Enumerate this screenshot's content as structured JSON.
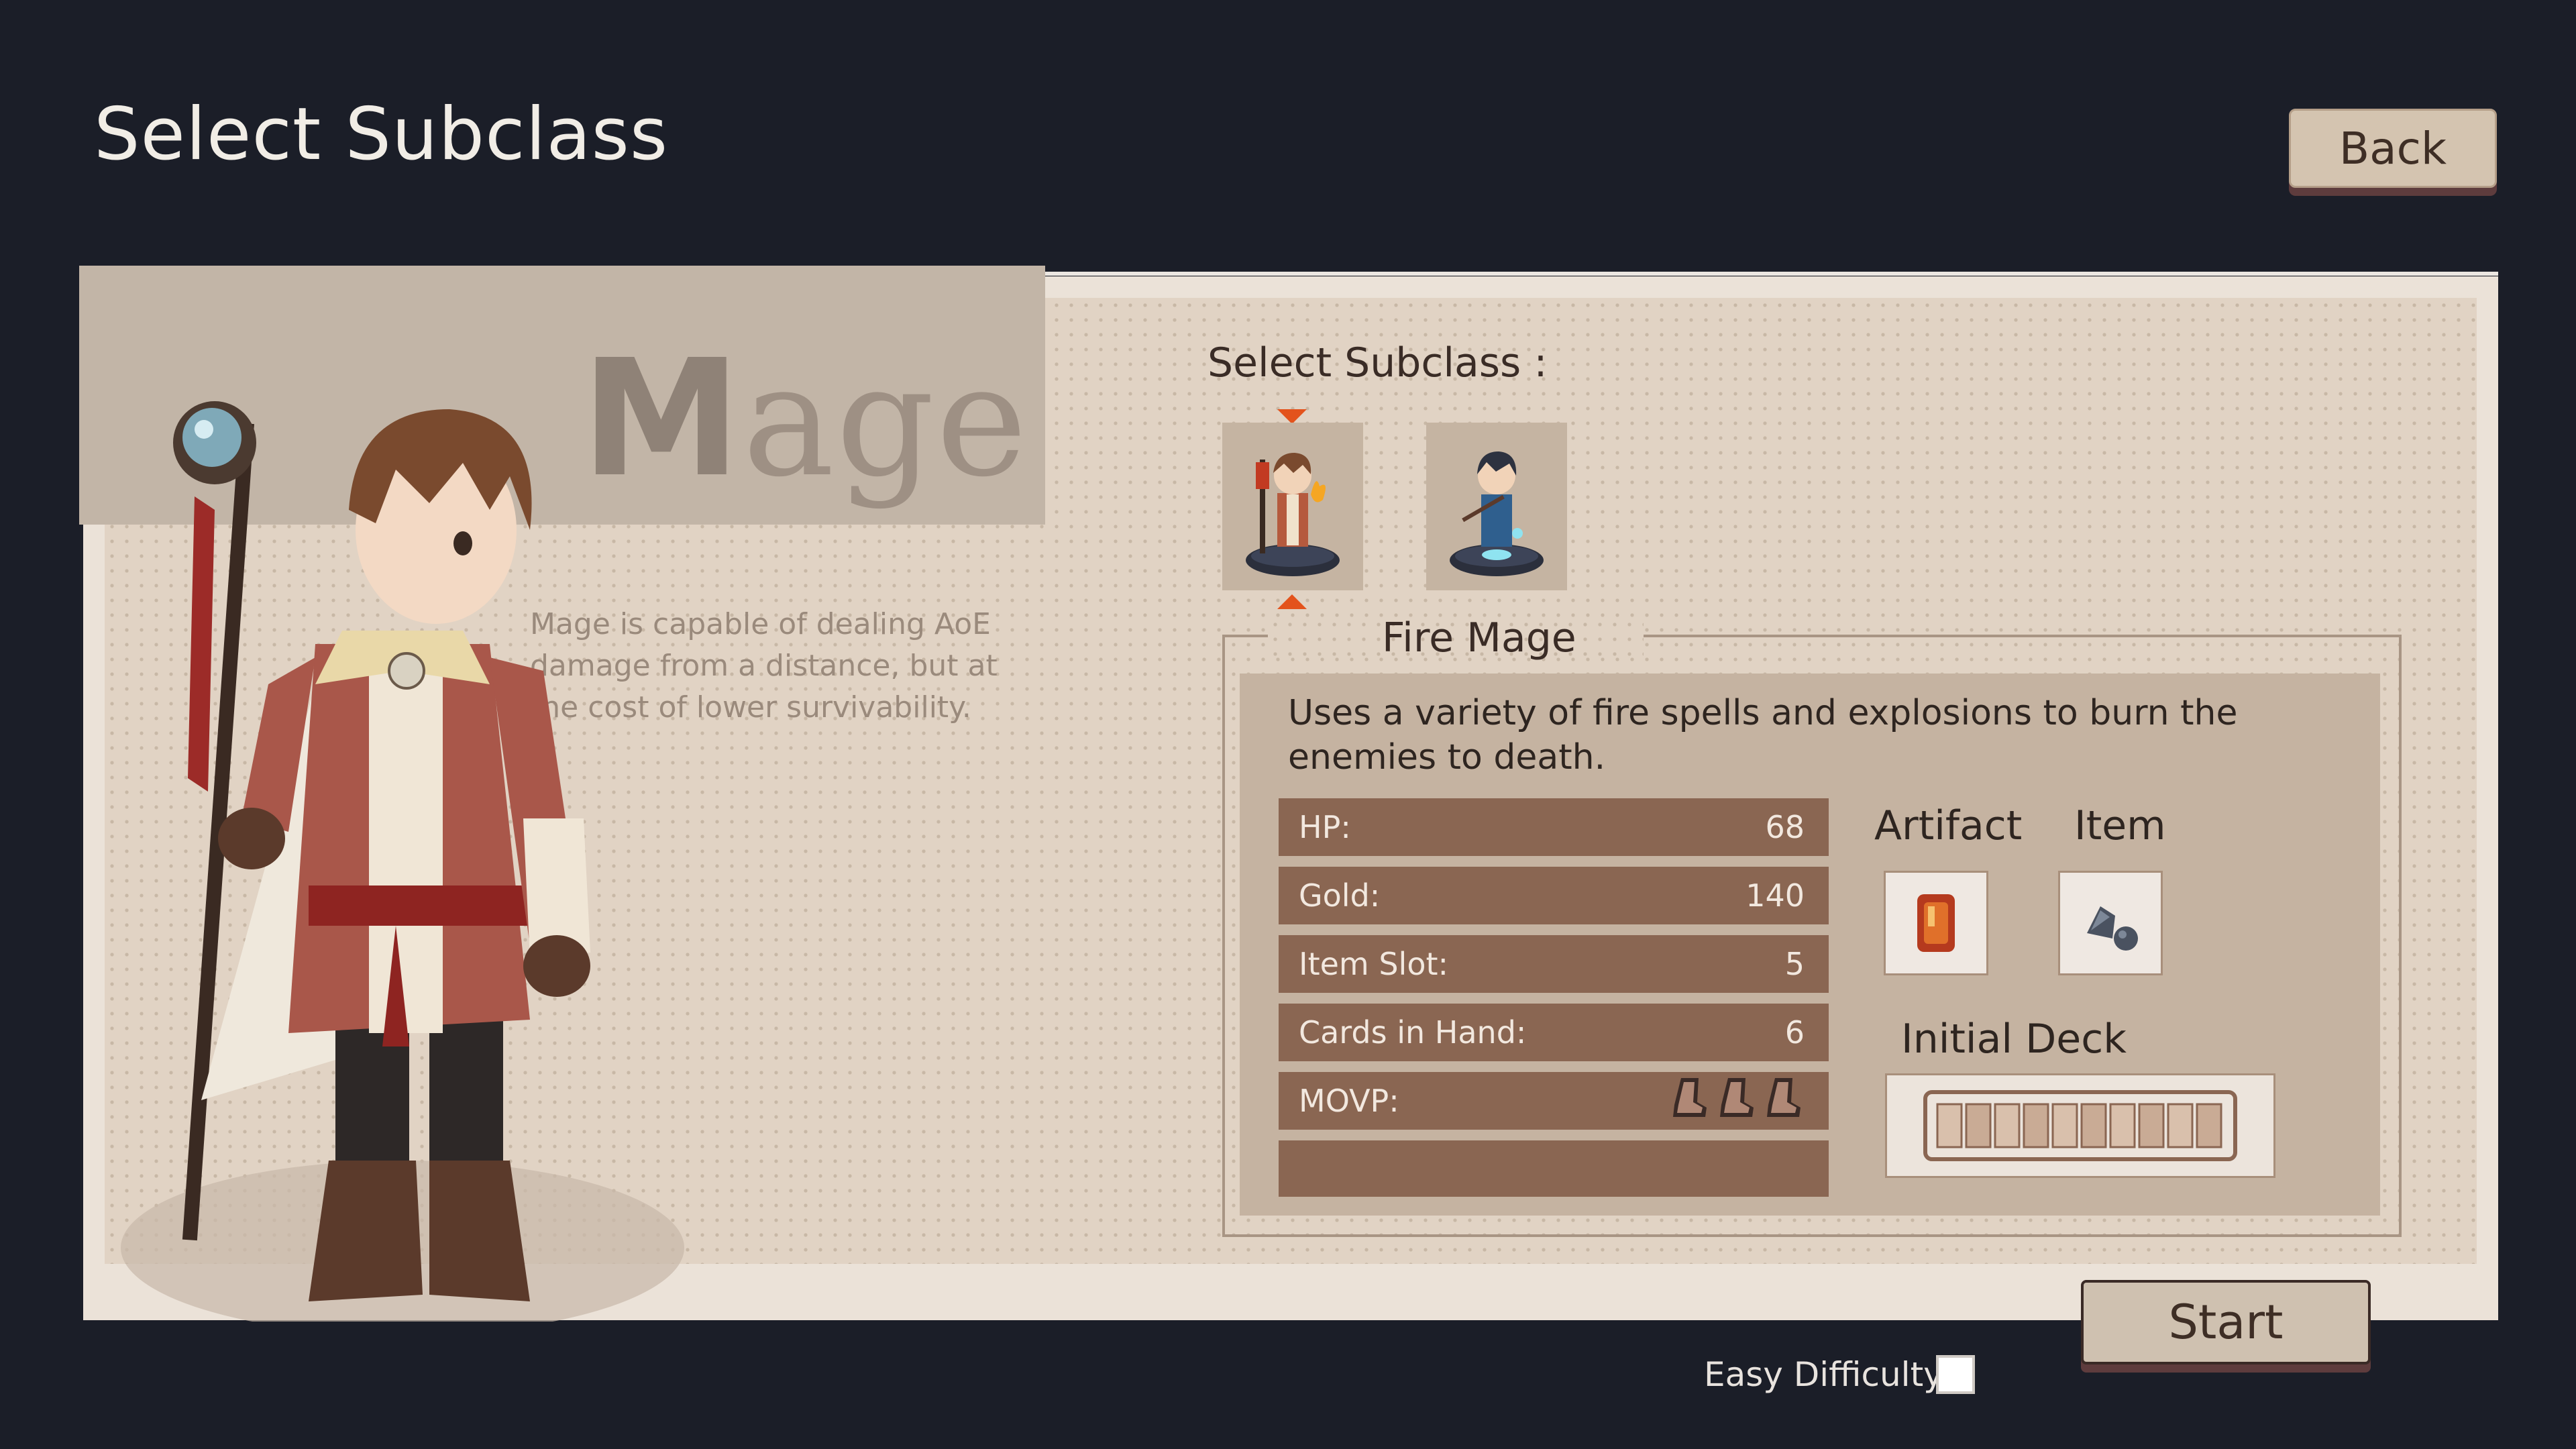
{
  "header": {
    "title": "Select Subclass",
    "back_label": "Back"
  },
  "class_panel": {
    "class_name": "Mage",
    "description": "Mage is capable of dealing AoE damage from a distance, but at the cost of lower survivability."
  },
  "subclass": {
    "heading": "Select Subclass :",
    "options": [
      {
        "icon": "fire-mage-figure",
        "selected": true
      },
      {
        "icon": "ice-mage-figure",
        "selected": false
      }
    ],
    "selected_name": "Fire Mage",
    "description": "Uses a variety of fire spells and explosions to burn the enemies to death."
  },
  "stats": [
    {
      "label": "HP:",
      "value": "68"
    },
    {
      "label": "Gold:",
      "value": "140"
    },
    {
      "label": "Item Slot:",
      "value": "5"
    },
    {
      "label": "Cards in Hand:",
      "value": "6"
    },
    {
      "label": "MOVP:",
      "value": 3,
      "icon": "boot-icon"
    }
  ],
  "loadout": {
    "artifact_label": "Artifact",
    "item_label": "Item",
    "deck_label": "Initial Deck",
    "artifact_icon": "red-gem-icon",
    "item_icon": "stones-icon",
    "deck_icon": "card-deck-icon"
  },
  "footer": {
    "start_label": "Start",
    "easy_label": "Easy Difficulty",
    "easy_checked": false
  },
  "colors": {
    "background": "#1b1e28",
    "stat_bar": "#8a6652",
    "selection_arrow": "#e3531c",
    "button_shadow": "#5e3c3d"
  }
}
